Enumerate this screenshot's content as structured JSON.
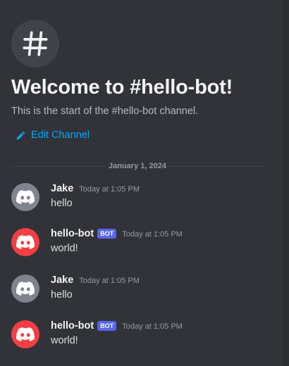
{
  "channel": {
    "welcome_title": "Welcome to #hello-bot!",
    "welcome_subtitle": "This is the start of the #hello-bot channel.",
    "edit_label": "Edit Channel",
    "icons": {
      "channel": "hash-icon",
      "edit": "pencil-icon"
    }
  },
  "divider": {
    "date": "January 1, 2024"
  },
  "messages": [
    {
      "author": "Jake",
      "bot": false,
      "bot_tag": "",
      "timestamp": "Today at 1:05 PM",
      "content": "hello",
      "avatar_color": "#80848e",
      "avatar_icon": "discord-logo-icon"
    },
    {
      "author": "hello-bot",
      "bot": true,
      "bot_tag": "BOT",
      "timestamp": "Today at 1:05 PM",
      "content": "world!",
      "avatar_color": "#f23f43",
      "avatar_icon": "discord-logo-icon"
    },
    {
      "author": "Jake",
      "bot": false,
      "bot_tag": "",
      "timestamp": "Today at 1:05 PM",
      "content": "hello",
      "avatar_color": "#80848e",
      "avatar_icon": "discord-logo-icon"
    },
    {
      "author": "hello-bot",
      "bot": true,
      "bot_tag": "BOT",
      "timestamp": "Today at 1:05 PM",
      "content": "world!",
      "avatar_color": "#f23f43",
      "avatar_icon": "discord-logo-icon"
    }
  ],
  "colors": {
    "background": "#313338",
    "link": "#00a8fc",
    "bot_tag": "#5865f2"
  }
}
